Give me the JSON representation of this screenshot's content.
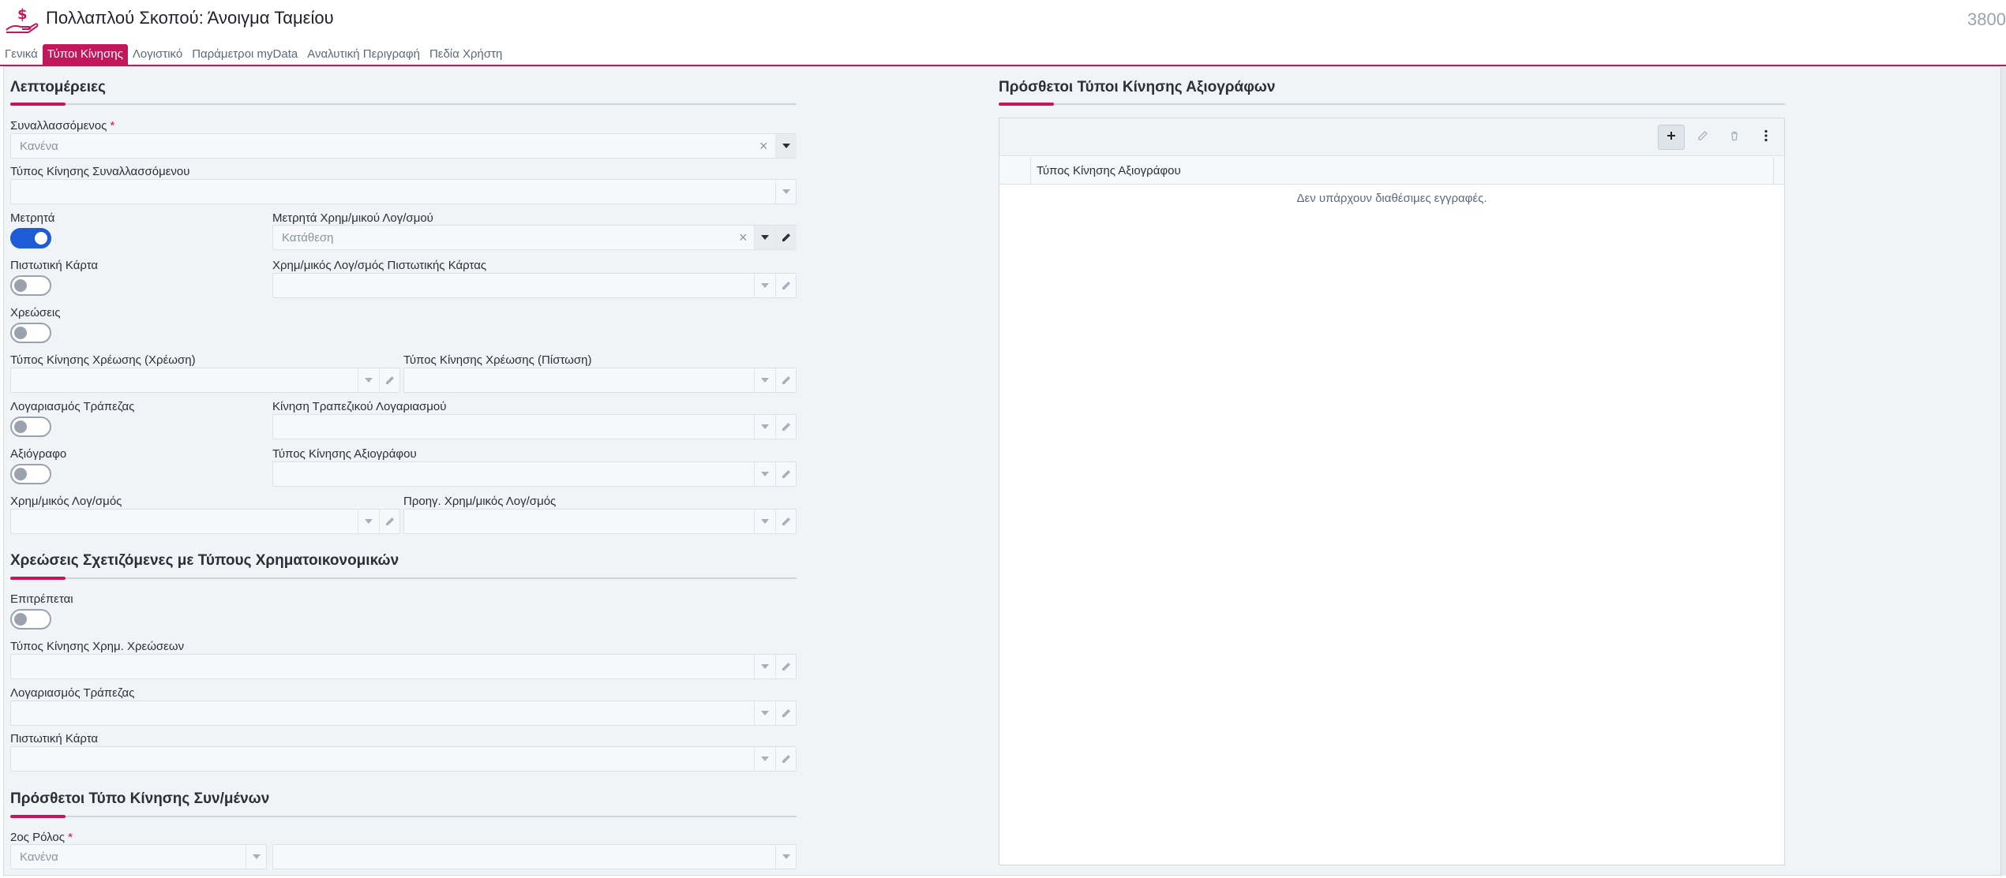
{
  "header": {
    "title": "Πολλαπλού Σκοπού: Άνοιγμα Ταμείου",
    "record_number": "3800"
  },
  "tabs": [
    {
      "label": "Γενικά",
      "active": false
    },
    {
      "label": "Τύποι Κίνησης",
      "active": true
    },
    {
      "label": "Λογιστικό",
      "active": false
    },
    {
      "label": "Παράμετροι myData",
      "active": false
    },
    {
      "label": "Αναλυτική Περιγραφή",
      "active": false
    },
    {
      "label": "Πεδία Χρήστη",
      "active": false
    }
  ],
  "details": {
    "title": "Λεπτομέρειες",
    "counterparty_label": "Συναλλασσόμενος",
    "counterparty_value": "Κανένα",
    "counterparty_type_label": "Τύπος Κίνησης Συναλλασσόμενου",
    "cash_label": "Μετρητά",
    "cash_on": true,
    "cash_account_label": "Μετρητά Χρημ/μικού Λογ/σμού",
    "cash_account_value": "Κατάθεση",
    "credit_card_label": "Πιστωτική Κάρτα",
    "credit_card_on": false,
    "credit_card_account_label": "Χρημ/μικός Λογ/σμός Πιστωτικής Κάρτας",
    "charges_label": "Χρεώσεις",
    "charges_on": false,
    "charge_debit_label": "Τύπος Κίνησης Χρέωσης (Χρέωση)",
    "charge_credit_label": "Τύπος Κίνησης Χρέωσης (Πίστωση)",
    "bank_account_label": "Λογαριασμός Τράπεζας",
    "bank_account_on": false,
    "bank_movement_label": "Κίνηση Τραπεζικού Λογαριασμού",
    "security_label": "Αξιόγραφο",
    "security_on": false,
    "security_type_label": "Τύπος Κίνησης Αξιογράφου",
    "fin_account_label": "Χρημ/μικός Λογ/σμός",
    "prev_fin_account_label": "Προηγ. Χρημ/μικός Λογ/σμός"
  },
  "charges_section": {
    "title": "Χρεώσεις Σχετιζόμενες με Τύπους Χρηματοικονομικών",
    "allowed_label": "Επιτρέπεται",
    "allowed_on": false,
    "fin_charge_type_label": "Τύπος Κίνησης Χρημ. Χρεώσεων",
    "bank_account_label": "Λογαριασμός Τράπεζας",
    "credit_card_label": "Πιστωτική Κάρτα"
  },
  "extra_counterparty": {
    "title": "Πρόσθετοι Τύπο Κίνησης Συν/μένων",
    "second_role_label": "2ος Ρόλος",
    "second_role_value": "Κανένα"
  },
  "securities_grid": {
    "title": "Πρόσθετοι Τύποι Κίνησης Αξιογράφων",
    "column": "Τύπος Κίνησης Αξιογράφου",
    "empty_text": "Δεν υπάρχουν διαθέσιμες εγγραφές."
  },
  "colors": {
    "accent": "#c2185b",
    "toggle_on": "#1e5bd6"
  },
  "icons": [
    "money-hand-icon",
    "clear-icon",
    "chevron-down-icon",
    "pencil-icon",
    "plus-icon",
    "trash-icon",
    "more-vertical-icon"
  ]
}
